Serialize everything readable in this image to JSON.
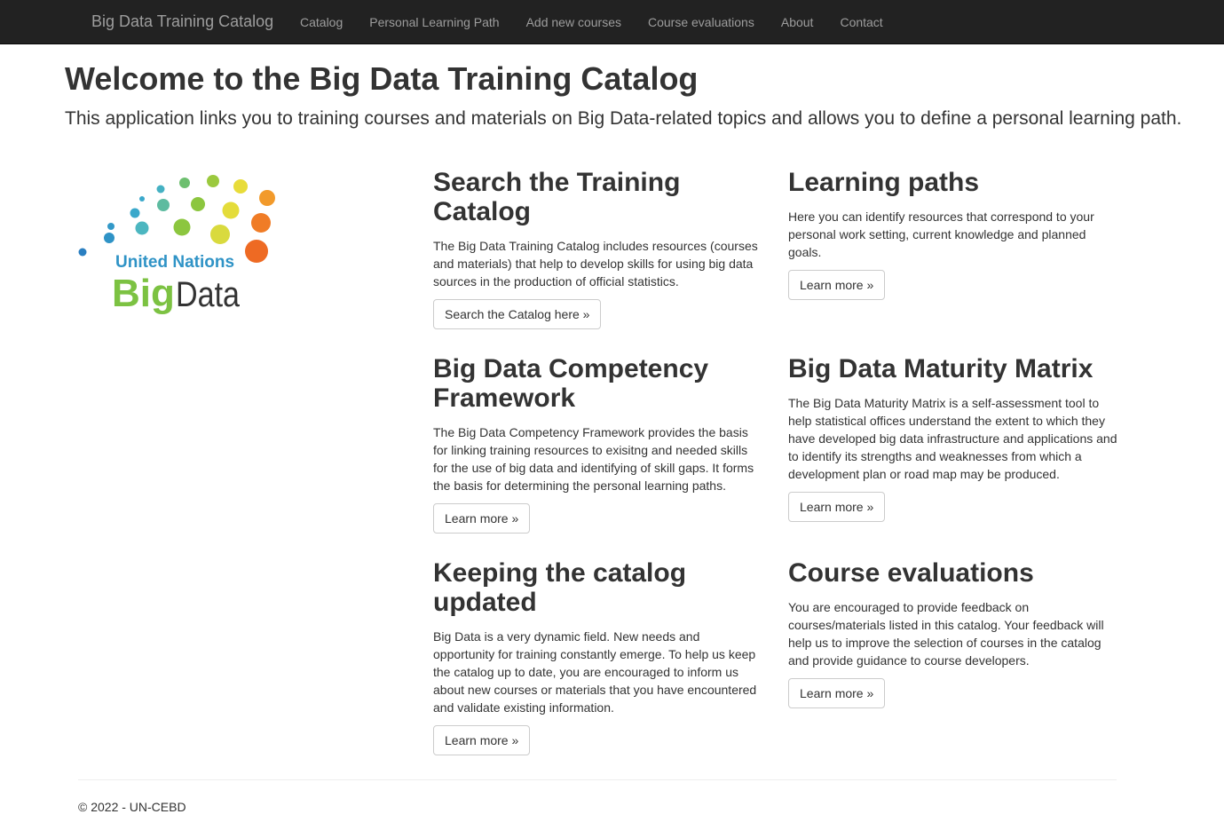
{
  "navbar": {
    "brand": "Big Data Training Catalog",
    "links": [
      "Catalog",
      "Personal Learning Path",
      "Add new courses",
      "Course evaluations",
      "About",
      "Contact"
    ]
  },
  "jumbotron": {
    "title": "Welcome to the Big Data Training Catalog",
    "lead": "This application links you to training courses and materials on Big Data-related topics and allows you to define a personal learning path."
  },
  "logo": {
    "line1": "United Nations",
    "word_big": "Big",
    "word_data": "Data",
    "colors": {
      "blue": "#2a7fc1",
      "teal": "#3bb0c9",
      "green": "#7cc242",
      "yellow": "#e3dc3a",
      "orange": "#f07c26"
    }
  },
  "sections": [
    {
      "title": "Search the Training Catalog",
      "text": "The Big Data Training Catalog includes resources (courses and materials) that help to develop skills for using big data sources in the production of official statistics.",
      "button": "Search the Catalog here »"
    },
    {
      "title": "Learning paths",
      "text": "Here you can identify resources that correspond to your personal work setting, current knowledge and planned goals.",
      "button": "Learn more »"
    },
    {
      "title": "Big Data Competency Framework",
      "text": "The Big Data Competency Framework provides the basis for linking training resources to exisitng and needed skills for the use of big data and identifying of skill gaps. It forms the basis for determining the personal learning paths.",
      "button": "Learn more »"
    },
    {
      "title": "Big Data Maturity Matrix",
      "text": "The Big Data Maturity Matrix is a self-assessment tool to help statistical offices understand the extent to which they have developed big data infrastructure and applications and to identify its strengths and weaknesses from which a development plan or road map may be produced.",
      "button": "Learn more »"
    },
    {
      "title": "Keeping the catalog updated",
      "text": "Big Data is a very dynamic field. New needs and opportunity for training constantly emerge. To help us keep the catalog up to date, you are encouraged to inform us about new courses or materials that you have encountered and validate existing information.",
      "button": "Learn more »"
    },
    {
      "title": "Course evaluations",
      "text": "You are encouraged to provide feedback on courses/materials listed in this catalog. Your feedback will help us to improve the selection of courses in the catalog and provide guidance to course developers.",
      "button": "Learn more »"
    }
  ],
  "footer": {
    "text": "© 2022 - UN-CEBD"
  }
}
